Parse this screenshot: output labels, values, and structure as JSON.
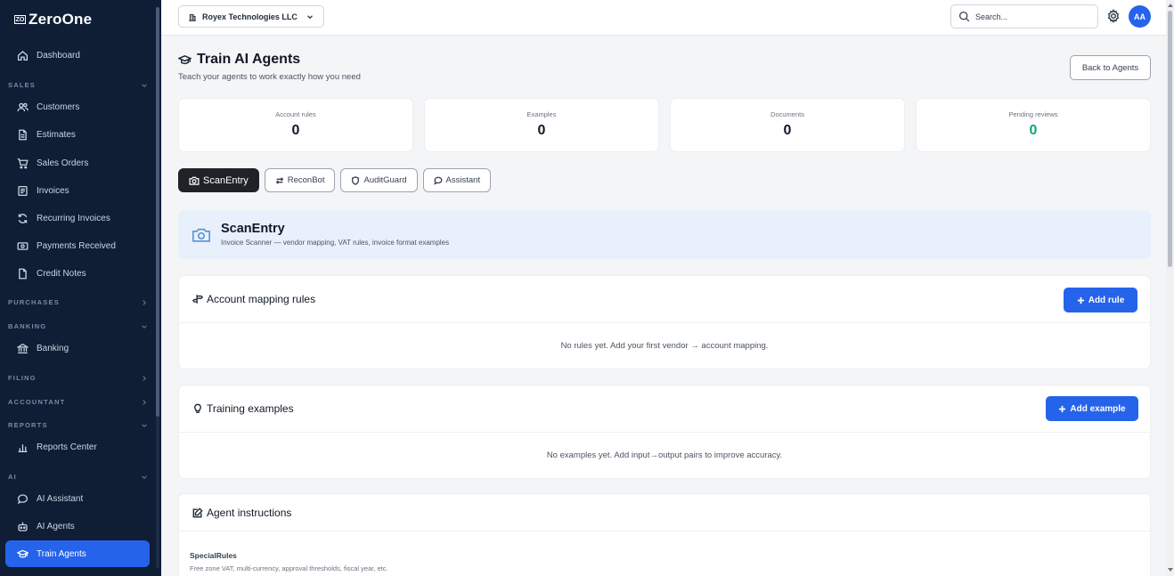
{
  "app": {
    "logo_mark": "ZO",
    "logo_text": "ZeroOne"
  },
  "sidebar": {
    "dashboard": "Dashboard",
    "sections": {
      "sales": "SALES",
      "purchases": "PURCHASES",
      "banking": "BANKING",
      "filing": "FILING",
      "accountant": "ACCOUNTANT",
      "reports": "REPORTS",
      "ai": "AI"
    },
    "items": {
      "customers": "Customers",
      "estimates": "Estimates",
      "sales_orders": "Sales Orders",
      "invoices": "Invoices",
      "recurring_invoices": "Recurring Invoices",
      "payments_received": "Payments Received",
      "credit_notes": "Credit Notes",
      "banking": "Banking",
      "reports_center": "Reports Center",
      "ai_assistant": "AI Assistant",
      "ai_agents": "AI Agents",
      "train_agents": "Train Agents"
    },
    "active": "train_agents"
  },
  "topbar": {
    "company": "Royex Technologies LLC",
    "search_placeholder": "Search...",
    "avatar_initials": "AA"
  },
  "page": {
    "title": "Train AI Agents",
    "subtitle": "Teach your agents to work exactly how you need",
    "back_button": "Back to Agents"
  },
  "stats": [
    {
      "label": "Account rules",
      "value": "0"
    },
    {
      "label": "Examples",
      "value": "0"
    },
    {
      "label": "Documents",
      "value": "0"
    },
    {
      "label": "Pending reviews",
      "value": "0"
    }
  ],
  "tabs": [
    {
      "label": "ScanEntry",
      "icon": "camera-icon",
      "active": true
    },
    {
      "label": "ReconBot",
      "icon": "arrows-icon",
      "active": false
    },
    {
      "label": "AuditGuard",
      "icon": "shield-icon",
      "active": false
    },
    {
      "label": "Assistant",
      "icon": "chat-icon",
      "active": false
    }
  ],
  "agent": {
    "name": "ScanEntry",
    "description": "Invoice Scanner — vendor mapping, VAT rules, invoice format examples"
  },
  "rules_card": {
    "title": "Account mapping rules",
    "button": "Add rule",
    "empty": "No rules yet. Add your first vendor → account mapping."
  },
  "examples_card": {
    "title": "Training examples",
    "button": "Add example",
    "empty": "No examples yet. Add input→output pairs to improve accuracy."
  },
  "instructions_card": {
    "title": "Agent instructions",
    "field_label": "SpecialRules",
    "field_help": "Free zone VAT, multi-currency, approval thresholds, fiscal year, etc."
  },
  "colors": {
    "sidebar_bg": "#0f1d35",
    "accent": "#2563eb",
    "success": "#10a37f",
    "banner_bg": "#e8f1fb"
  }
}
